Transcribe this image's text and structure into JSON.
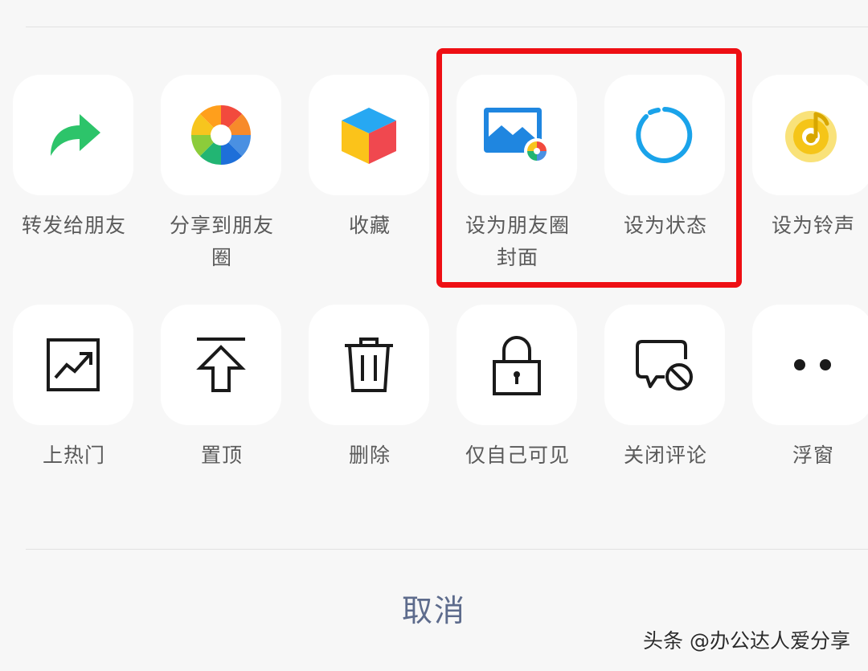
{
  "share_sheet": {
    "row1": [
      {
        "label": "转发给朋友",
        "icon": "forward-arrow-icon"
      },
      {
        "label": "分享到朋友圈",
        "icon": "moments-aperture-icon"
      },
      {
        "label": "收藏",
        "icon": "favorites-cube-icon"
      },
      {
        "label": "设为朋友圈封面",
        "icon": "moments-cover-image-icon"
      },
      {
        "label": "设为状态",
        "icon": "status-ring-icon"
      },
      {
        "label": "设为铃声",
        "icon": "ringtone-music-icon"
      }
    ],
    "row2": [
      {
        "label": "上热门",
        "icon": "trending-chart-icon"
      },
      {
        "label": "置顶",
        "icon": "pin-top-arrow-icon"
      },
      {
        "label": "删除",
        "icon": "trash-icon"
      },
      {
        "label": "仅自己可见",
        "icon": "lock-icon"
      },
      {
        "label": "关闭评论",
        "icon": "comment-disabled-icon"
      },
      {
        "label": "浮窗",
        "icon": "more-dots-icon"
      }
    ],
    "cancel_label": "取消"
  },
  "watermark": "头条 @办公达人爱分享",
  "colors": {
    "forward_green": "#2dc46a",
    "highlight_red": "#ee0f14",
    "cover_blue": "#1f86e0",
    "status_blue": "#1aa3ea",
    "ringtone_yellow": "#f5c518",
    "cancel_text": "#5d6b8c"
  }
}
